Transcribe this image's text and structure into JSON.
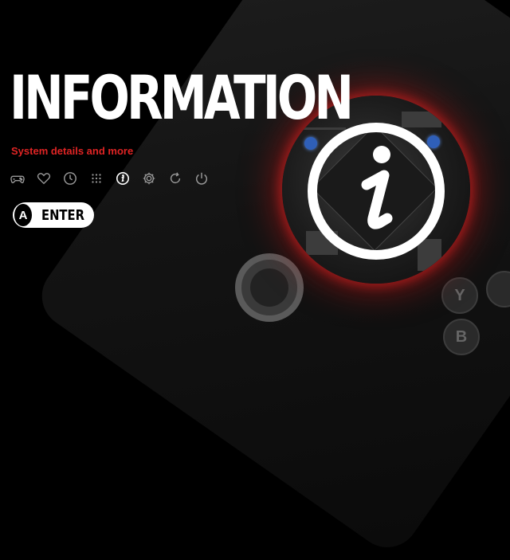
{
  "header": {
    "title": "INFORMATION",
    "subtitle": "System details and more"
  },
  "nav": {
    "items": [
      {
        "name": "gamepad-icon",
        "active": false
      },
      {
        "name": "heart-icon",
        "active": false
      },
      {
        "name": "clock-icon",
        "active": false
      },
      {
        "name": "grid-icon",
        "active": false
      },
      {
        "name": "info-icon",
        "active": true
      },
      {
        "name": "gear-icon",
        "active": false
      },
      {
        "name": "refresh-icon",
        "active": false
      },
      {
        "name": "power-icon",
        "active": false
      }
    ]
  },
  "action": {
    "key": "A",
    "label": "ENTER"
  },
  "background": {
    "button_y": "Y",
    "button_b": "B"
  },
  "colors": {
    "accent": "#e02424",
    "text": "#ffffff",
    "inactive_icon": "#9a9a9a",
    "background": "#000000"
  }
}
